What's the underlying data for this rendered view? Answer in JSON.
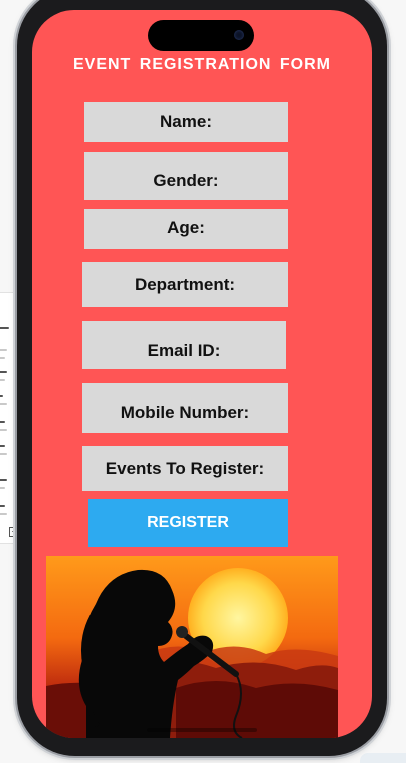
{
  "form": {
    "title": "EVENT REGISTRATION FORM",
    "fields": {
      "name": "Name:",
      "gender": "Gender:",
      "age": "Age:",
      "department": "Department:",
      "email": "Email ID:",
      "mobile": "Mobile Number:",
      "events": "Events To Register:"
    },
    "register_label": "REGISTER"
  },
  "colors": {
    "screen_background": "#ff5555",
    "field_background": "#d9d9d9",
    "register_button": "#2daaf0"
  },
  "banner": {
    "icon": "singer-silhouette-sunset-image"
  }
}
